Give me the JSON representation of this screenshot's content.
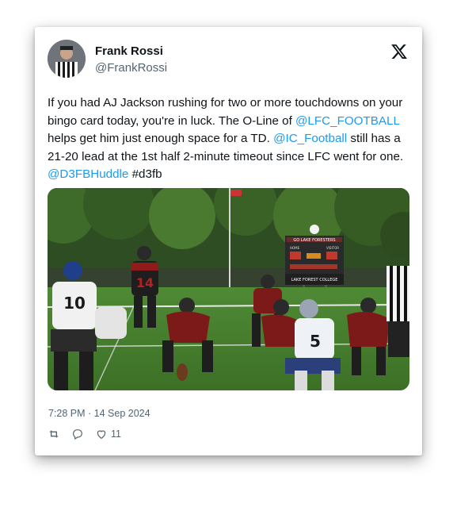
{
  "tweet": {
    "author_name": "Frank Rossi",
    "author_handle": "@FrankRossi",
    "text_part1": "If you had AJ Jackson rushing for two or more touchdowns on your bingo card today, you're in luck. The O-Line of ",
    "mention1": "@LFC_FOOTBALL",
    "text_part2": " helps get him just enough space for a TD. ",
    "mention2": "@IC_Football",
    "text_part3": " still has a 21-20 lead at the 1st half 2-minute timeout since LFC went for one. ",
    "mention3": "@D3FBHuddle",
    "text_part4": " ",
    "hashtag": "#d3fb",
    "timestamp": "7:28 PM · 14 Sep 2024",
    "like_count": "11"
  },
  "media": {
    "jersey_white_left": "10",
    "jersey_red": "14",
    "jersey_white_right": "5",
    "scoreboard_banner": "GO LAKE FORESTERS",
    "scoreboard_home": "HOME",
    "scoreboard_visitor": "VISITOR",
    "scoreboard_sign": "LAKE FOREST COLLEGE"
  },
  "icons": {
    "logo": "x-logo-icon",
    "retweet": "retweet-icon",
    "reply": "reply-icon",
    "like": "heart-icon"
  },
  "colors": {
    "link": "#1d9bf0",
    "secondary_text": "#536471"
  }
}
